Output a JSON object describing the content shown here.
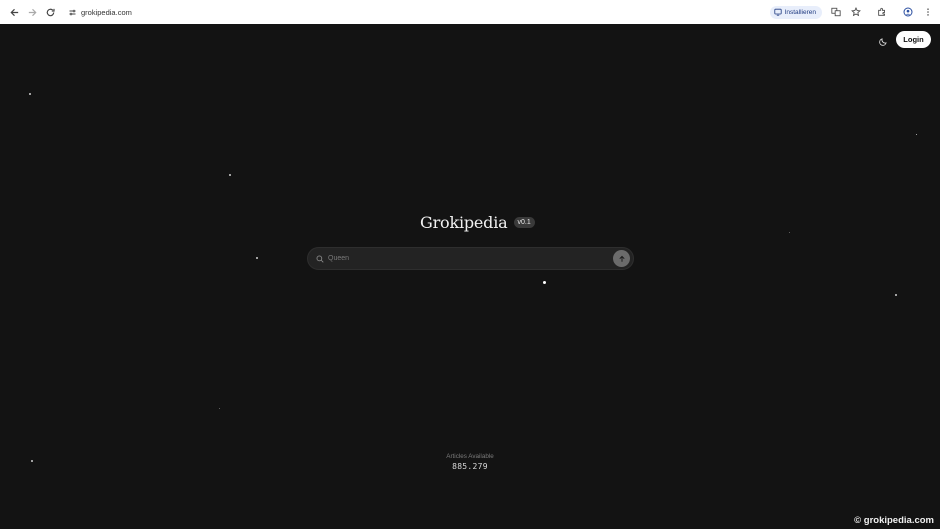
{
  "browser": {
    "url": "grokipedia.com",
    "install_label": "Installieren"
  },
  "header": {
    "login_label": "Login",
    "theme_icon": "moon-icon"
  },
  "main": {
    "title": "Grokipedia",
    "version": "v0.1",
    "search": {
      "placeholder": "Queen",
      "value": ""
    }
  },
  "footer": {
    "articles_label": "Articles Available",
    "articles_count": "885.279"
  },
  "watermark": "© grokipedia.com",
  "colors": {
    "background": "#131313",
    "search_bg": "#232323",
    "login_bg": "#ffffff",
    "submit_bg": "#6b6b6b"
  }
}
